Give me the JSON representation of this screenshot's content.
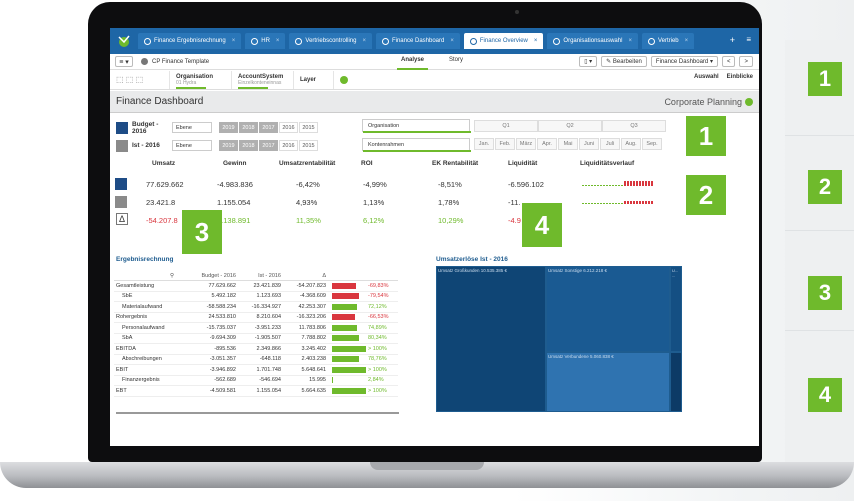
{
  "tabs": [
    {
      "label": "Finance Ergebnisrechnung",
      "active": false
    },
    {
      "label": "HR",
      "active": false
    },
    {
      "label": "Vertriebscontrolling",
      "active": false
    },
    {
      "label": "Finance Dashboard",
      "active": false
    },
    {
      "label": "Finance Overview",
      "active": true
    },
    {
      "label": "Organisationsauswahl",
      "active": false
    },
    {
      "label": "Vertrieb",
      "active": false
    }
  ],
  "toolbar": {
    "app_title": "CP Finance Template",
    "analyse": "Analyse",
    "story": "Story",
    "bearbeiten": "Bearbeiten",
    "sheet": "Finance Dashboard",
    "nav_prev": "<",
    "nav_next": ">"
  },
  "selections": {
    "org_title": "Organisation",
    "org_sub": "01 Hydra",
    "acct_title": "AccountSystem",
    "acct_sub": "Einzelkonteneinnas",
    "layer": "Layer",
    "auswahl": "Auswahl",
    "einblicke": "Einblicke"
  },
  "header": {
    "title": "Finance Dashboard",
    "brand": "Corporate Planning"
  },
  "filters": {
    "budget_label": "Budget - 2016",
    "ist_label": "Ist - 2016",
    "ebene": "Ebene",
    "years": [
      "2019",
      "2018",
      "2017",
      "2016",
      "2015"
    ],
    "org": "Organisation",
    "konten": "Kontenrahmen",
    "quarters": [
      "Q1",
      "Q2",
      "Q3"
    ],
    "months": [
      "Jan.",
      "Feb.",
      "März",
      "Apr.",
      "Mai",
      "Juni",
      "Juli",
      "Aug.",
      "Sep."
    ]
  },
  "kpi": {
    "headers": [
      "Umsatz",
      "Gewinn",
      "Umsatzrentabilität",
      "ROI",
      "EK Rentabilität",
      "Liquidität",
      "Liquiditätsverlauf"
    ],
    "budget": [
      "77.629.662",
      "-4.983.836",
      "-6,42%",
      "-4,99%",
      "-8,51%",
      "-6.596.102"
    ],
    "ist": [
      "23.421.8",
      "1.155.054",
      "4,93%",
      "1,13%",
      "1,78%",
      "-11."
    ],
    "delta_symbol": "Δ",
    "delta": [
      "-54.207.8",
      "6.138.891",
      "11,35%",
      "6,12%",
      "10,29%",
      "-4.9"
    ]
  },
  "ergebnis": {
    "title": "Ergebnisrechnung",
    "search_icon": "search-icon",
    "cols": [
      "Budget - 2016",
      "Ist - 2016",
      "Δ"
    ],
    "rows": [
      {
        "name": "Gesamtleistung",
        "b": "77.629.662",
        "i": "23.421.839",
        "d": "-54.207.823",
        "pct": "-69,83%",
        "val": -69.83
      },
      {
        "name": "  SbE",
        "b": "5.492.182",
        "i": "1.123.693",
        "d": "-4.368.609",
        "pct": "-79,54%",
        "val": -79.54
      },
      {
        "name": "  Materialaufwand",
        "b": "-58.588.234",
        "i": "-16.334.927",
        "d": "42.253.307",
        "pct": "72,12%",
        "val": 72.12
      },
      {
        "name": "Rohergebnis",
        "b": "24.533.810",
        "i": "8.210.604",
        "d": "-16.323.206",
        "pct": "-66,53%",
        "val": -66.53
      },
      {
        "name": "  Personalaufwand",
        "b": "-15.735.037",
        "i": "-3.951.233",
        "d": "11.783.806",
        "pct": "74,89%",
        "val": 74.89
      },
      {
        "name": "  SbA",
        "b": "-9.694.309",
        "i": "-1.905.507",
        "d": "7.788.802",
        "pct": "80,34%",
        "val": 80.34
      },
      {
        "name": "EBITDA",
        "b": "-895.536",
        "i": "2.349.866",
        "d": "3.245.402",
        "pct": "> 100%",
        "val": 100
      },
      {
        "name": "  Abschreibungen",
        "b": "-3.051.357",
        "i": "-648.118",
        "d": "2.403.238",
        "pct": "78,76%",
        "val": 78.76
      },
      {
        "name": "EBIT",
        "b": "-3.946.892",
        "i": "1.701.748",
        "d": "5.648.641",
        "pct": "> 100%",
        "val": 100
      },
      {
        "name": "  Finanzergebnis",
        "b": "-562.689",
        "i": "-546.694",
        "d": "15.995",
        "pct": "2,84%",
        "val": 2.84
      },
      {
        "name": "EBT",
        "b": "-4.509.581",
        "i": "1.155.054",
        "d": "5.664.635",
        "pct": "> 100%",
        "val": 100
      }
    ]
  },
  "umsatz": {
    "title": "Umsatzerlöse Ist - 2016",
    "cells": [
      {
        "label": "Umsatz Großkunden 10.535.385 €"
      },
      {
        "label": "Umsatz Sonstige 6.212.218 €"
      },
      {
        "label": "Umsatz Verbundene 5.060.838 €"
      },
      {
        "label": "U... ..."
      }
    ]
  },
  "badges": [
    "1",
    "2",
    "3",
    "4"
  ],
  "colors": {
    "green": "#6fba2c",
    "navy": "#1e4c86",
    "gray": "#8a8a8a",
    "red": "#d9363e",
    "tabblue": "#1e66a6"
  }
}
